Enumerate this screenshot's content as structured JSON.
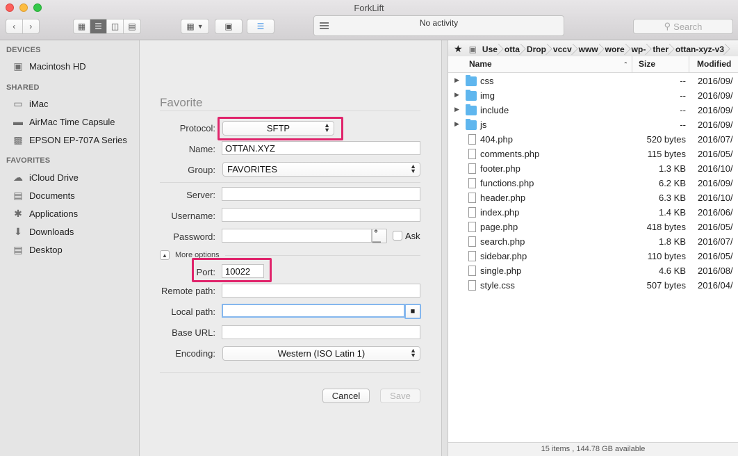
{
  "window": {
    "title": "ForkLift"
  },
  "toolbar": {
    "activity_text": "No activity",
    "search_placeholder": "Search",
    "view_modes": [
      "icon-view",
      "list-view",
      "column-view",
      "coverflow-view"
    ],
    "active_view": "list-view"
  },
  "sidebar": {
    "sections": [
      {
        "title": "DEVICES",
        "items": [
          {
            "label": "Macintosh HD",
            "icon": "harddisk-icon"
          }
        ]
      },
      {
        "title": "SHARED",
        "items": [
          {
            "label": "iMac",
            "icon": "monitor-icon"
          },
          {
            "label": "AirMac Time Capsule",
            "icon": "time-capsule-icon"
          },
          {
            "label": "EPSON EP-707A Series",
            "icon": "printer-icon"
          }
        ]
      },
      {
        "title": "FAVORITES",
        "items": [
          {
            "label": "iCloud Drive",
            "icon": "cloud-icon"
          },
          {
            "label": "Documents",
            "icon": "documents-icon"
          },
          {
            "label": "Applications",
            "icon": "applications-icon"
          },
          {
            "label": "Downloads",
            "icon": "downloads-icon"
          },
          {
            "label": "Desktop",
            "icon": "desktop-icon"
          }
        ]
      }
    ]
  },
  "favorite_form": {
    "title": "Favorite",
    "protocol_label": "Protocol:",
    "protocol_value": "SFTP",
    "name_label": "Name:",
    "name_value": "OTTAN.XYZ",
    "group_label": "Group:",
    "group_value": "FAVORITES",
    "server_label": "Server:",
    "server_value": "",
    "username_label": "Username:",
    "username_value": "",
    "password_label": "Password:",
    "password_value": "",
    "ask_label": "Ask",
    "ask_checked": false,
    "more_options_label": "More options",
    "port_label": "Port:",
    "port_value": "10022",
    "remote_path_label": "Remote path:",
    "remote_path_value": "",
    "local_path_label": "Local path:",
    "local_path_value": "",
    "base_url_label": "Base URL:",
    "base_url_value": "",
    "encoding_label": "Encoding:",
    "encoding_value": "Western (ISO Latin 1)",
    "cancel_label": "Cancel",
    "save_label": "Save",
    "highlight_color": "#e0246b"
  },
  "file_browser": {
    "breadcrumbs": [
      "Use",
      "otta",
      "Drop",
      "vccv",
      "www",
      "wore",
      "wp-",
      "ther",
      "ottan-xyz-v3"
    ],
    "columns": {
      "name": "Name",
      "size": "Size",
      "modified": "Modified"
    },
    "rows": [
      {
        "name": "css",
        "kind": "folder",
        "size": "--",
        "modified": "2016/09/"
      },
      {
        "name": "img",
        "kind": "folder",
        "size": "--",
        "modified": "2016/09/"
      },
      {
        "name": "include",
        "kind": "folder",
        "size": "--",
        "modified": "2016/09/"
      },
      {
        "name": "js",
        "kind": "folder",
        "size": "--",
        "modified": "2016/09/"
      },
      {
        "name": "404.php",
        "kind": "file",
        "size": "520 bytes",
        "modified": "2016/07/"
      },
      {
        "name": "comments.php",
        "kind": "file",
        "size": "115 bytes",
        "modified": "2016/05/"
      },
      {
        "name": "footer.php",
        "kind": "file",
        "size": "1.3 KB",
        "modified": "2016/10/"
      },
      {
        "name": "functions.php",
        "kind": "file",
        "size": "6.2 KB",
        "modified": "2016/09/"
      },
      {
        "name": "header.php",
        "kind": "file",
        "size": "6.3 KB",
        "modified": "2016/10/"
      },
      {
        "name": "index.php",
        "kind": "file",
        "size": "1.4 KB",
        "modified": "2016/06/"
      },
      {
        "name": "page.php",
        "kind": "file",
        "size": "418 bytes",
        "modified": "2016/05/"
      },
      {
        "name": "search.php",
        "kind": "file",
        "size": "1.8 KB",
        "modified": "2016/07/"
      },
      {
        "name": "sidebar.php",
        "kind": "file",
        "size": "110 bytes",
        "modified": "2016/05/"
      },
      {
        "name": "single.php",
        "kind": "file",
        "size": "4.6 KB",
        "modified": "2016/08/"
      },
      {
        "name": "style.css",
        "kind": "file",
        "size": "507 bytes",
        "modified": "2016/04/"
      }
    ],
    "status": "15 items , 144.78 GB available"
  }
}
